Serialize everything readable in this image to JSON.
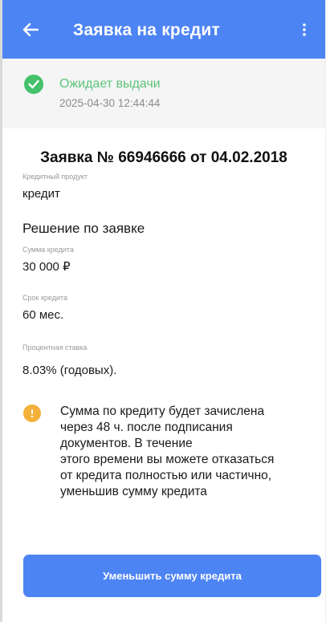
{
  "app_bar": {
    "title": "Заявка на кредит",
    "back_icon": "arrow-left-icon",
    "menu_icon": "more-vertical-icon",
    "color": "#4d84f4"
  },
  "status": {
    "title": "Ожидает выдачи",
    "datetime": "2025-04-30 12:44:44",
    "icon": "check-circle-icon",
    "color": "#43c16a"
  },
  "application": {
    "heading": "Заявка № 66946666 от 04.02.2018",
    "product_label": "Кредитный продукт",
    "product_value": "кредит"
  },
  "decision": {
    "title": "Решение по заявке",
    "amount_label": "Сумма кредита",
    "amount_value": "30 000 ₽",
    "term_label": "Срок кредита",
    "term_value": "60 мес.",
    "rate_label": "Процентная ставка",
    "rate_value": "8.03% (годовых)."
  },
  "notice": {
    "icon": "info-icon",
    "color": "#f3b13a",
    "lines": [
      "Сумма по кредиту будет зачислена",
      "через 48 ч. после подписания",
      "документов. В течение",
      "этого времени вы можете отказаться",
      "от кредита полностью или частично,",
      "уменьшив сумму кредита"
    ]
  },
  "actions": {
    "reduce_amount_label": "Уменьшить сумму кредита"
  }
}
